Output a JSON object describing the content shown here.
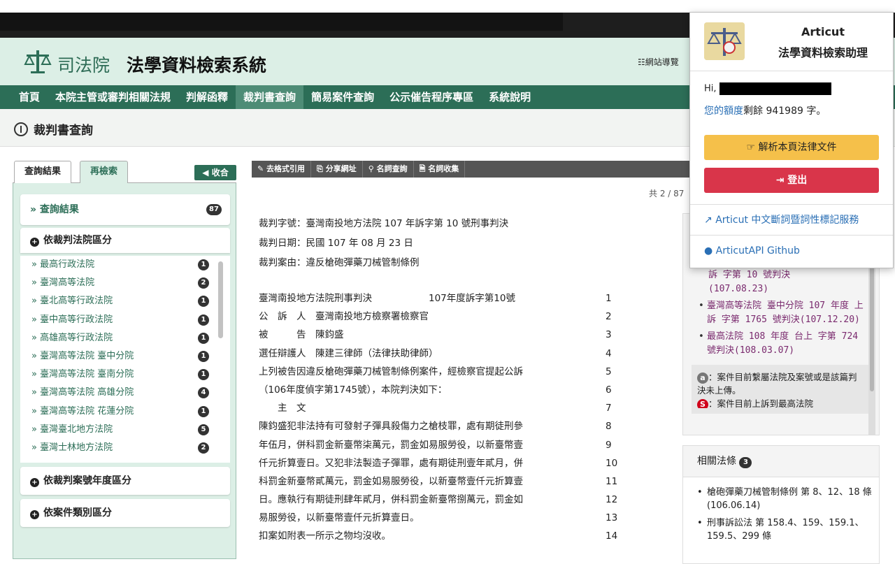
{
  "header": {
    "site_name": "司法院",
    "system_name": "法學資料檢索系統",
    "sitemap_label": "網站導覽"
  },
  "nav": {
    "items": [
      "首頁",
      "本院主管或審判相關法規",
      "判解函釋",
      "裁判書查詢",
      "簡易案件查詢",
      "公示催告程序專區",
      "系統說明"
    ],
    "active_index": 3
  },
  "page": {
    "title": "裁判書查詢"
  },
  "left_panel": {
    "tab_results": "查詢結果",
    "tab_research": "再檢索",
    "collapse_label": "收合",
    "results_label": "» 查詢結果",
    "results_count": "87",
    "section_court": "依裁判法院區分",
    "courts": [
      {
        "name": "» 最高行政法院",
        "count": "1"
      },
      {
        "name": "» 臺灣高等法院",
        "count": "2"
      },
      {
        "name": "» 臺北高等行政法院",
        "count": "1"
      },
      {
        "name": "» 臺中高等行政法院",
        "count": "1"
      },
      {
        "name": "» 高雄高等行政法院",
        "count": "1"
      },
      {
        "name": "» 臺灣高等法院 臺中分院",
        "count": "1"
      },
      {
        "name": "» 臺灣高等法院 臺南分院",
        "count": "1"
      },
      {
        "name": "» 臺灣高等法院 高雄分院",
        "count": "4"
      },
      {
        "name": "» 臺灣高等法院 花蓮分院",
        "count": "1"
      },
      {
        "name": "» 臺灣臺北地方法院",
        "count": "5"
      },
      {
        "name": "» 臺灣士林地方法院",
        "count": "2"
      }
    ],
    "section_year": "依裁判案號年度區分",
    "section_type": "依案件類別區分"
  },
  "toolbar": {
    "items": [
      "去格式引用",
      "分享網址",
      "名詞查詢",
      "名詞收集"
    ]
  },
  "pager": "共 2 / 87",
  "doc": {
    "case_no": "裁判字號：臺灣南投地方法院 107 年訴字第 10 號刑事判決",
    "date": "裁判日期：民國 107 年 08 月 23 日",
    "reason": "裁判案由：違反槍砲彈藥刀械管制條例",
    "lines": [
      {
        "text": "臺灣南投地方法院刑事判決　　　　　　107年度訴字第10號",
        "n": "1"
      },
      {
        "text": "公　訴　人　臺灣南投地方檢察署檢察官",
        "n": "2"
      },
      {
        "text": "被　　　告　陳鈞盛",
        "n": "3"
      },
      {
        "text": "選任辯護人　陳建三律師（法律扶助律師）",
        "n": "4"
      },
      {
        "text": "上列被告因違反槍砲彈藥刀械管制條例案件，經檢察官提起公訴",
        "n": "5"
      },
      {
        "text": "（106年度偵字第1745號），本院判決如下：",
        "n": "6"
      },
      {
        "text": "　　主　文",
        "n": "7"
      },
      {
        "text": "陳鈞盛犯非法持有可發射子彈具殺傷力之槍枝罪，處有期徒刑參",
        "n": "8"
      },
      {
        "text": "年伍月，併科罰金新臺幣柒萬元，罰金如易服勞役，以新臺幣壹",
        "n": "9"
      },
      {
        "text": "仟元折算壹日。又犯非法製造子彈罪，處有期徒刑壹年貳月，併",
        "n": "10"
      },
      {
        "text": "科罰金新臺幣貳萬元，罰金如易服勞役，以新臺幣壹仟元折算壹",
        "n": "11"
      },
      {
        "text": "日。應執行有期徒刑肆年貳月，併科罰金新臺幣捌萬元，罰金如",
        "n": "12"
      },
      {
        "text": "易服勞役，以新臺幣壹仟元折算壹日。",
        "n": "13"
      },
      {
        "text": "扣案如附表一所示之物均沒收。",
        "n": "14"
      }
    ]
  },
  "right": {
    "case_partial": "訴 字第 10 號判決\n(107.08.23)",
    "case_items": [
      "臺灣高等法院 臺中分院 107 年度 上訴 字第 1765 號判決(107.12.20)",
      "最高法院 108 年度 台上 字第 724 號判決(108.03.07)"
    ],
    "note_a": "：案件目前繫屬法院及案號或是該篇判決未上傳。",
    "note_s": "：案件目前上訴到最高法院",
    "law_head": "相關法條",
    "law_count": "3",
    "laws": [
      "槍砲彈藥刀械管制條例 第 8、12、18 條 (106.06.14)",
      "刑事訴訟法 第 158.4、159、159.1、159.5、299 條"
    ]
  },
  "popup": {
    "title1": "Articut",
    "title2": "法學資料檢索助理",
    "hi": "Hi,",
    "quota_link": "您的額度",
    "quota_text": "剩餘 941989 字。",
    "analyze_label": "解析本頁法律文件",
    "logout_label": "登出",
    "service_link": "Articut 中文斷詞暨詞性標記服務",
    "github_link": "ArticutAPI Github"
  },
  "colors": {
    "brand_green": "#2c6e57",
    "header_bg": "#dcefe6",
    "warning": "#f5c04a",
    "danger": "#d9354a",
    "link": "#2a6fb5"
  }
}
